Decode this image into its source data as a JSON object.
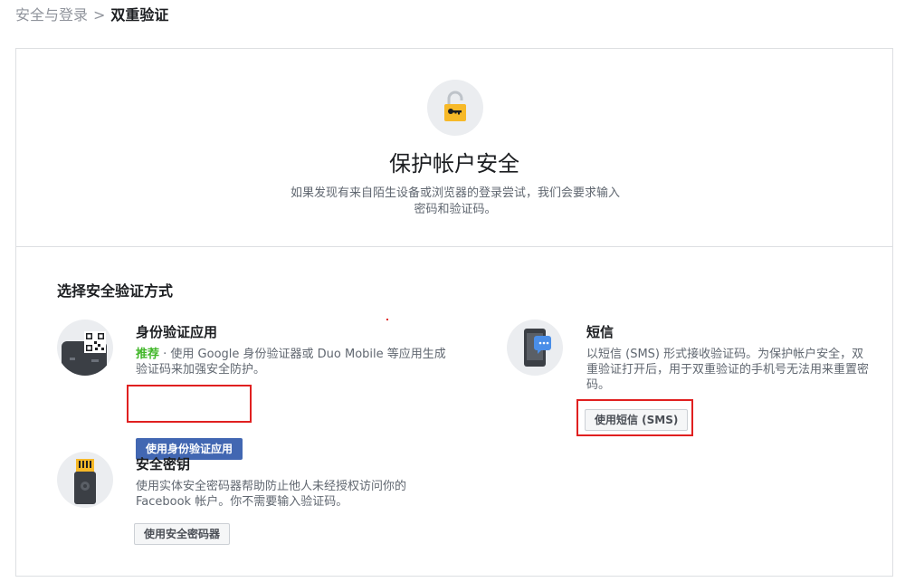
{
  "breadcrumb": {
    "parent": "安全与登录",
    "separator": ">",
    "current": "双重验证"
  },
  "hero": {
    "title": "保护帐户安全",
    "description": "如果发现有来自陌生设备或浏览器的登录尝试，我们会要求输入密码和验证码。"
  },
  "section": {
    "title": "选择安全验证方式"
  },
  "options": {
    "auth_app": {
      "title": "身份验证应用",
      "recommended": "推荐",
      "description": " · 使用 Google 身份验证器或 Duo Mobile 等应用生成验证码来加强安全防护。",
      "button": "使用身份验证应用"
    },
    "sms": {
      "title": "短信",
      "description": "以短信 (SMS) 形式接收验证码。为保护帐户安全，双重验证打开后，用于双重验证的手机号无法用来重置密码。",
      "button": "使用短信 (SMS)"
    },
    "security_key": {
      "title": "安全密钥",
      "description": "使用实体安全密码器帮助防止他人未经授权访问你的 Facebook 帐户。你不需要输入验证码。",
      "button": "使用安全密码器"
    }
  },
  "colors": {
    "primary": "#4267b2",
    "recommended": "#42b72a",
    "highlight": "#e02020",
    "lock": "#f7b928"
  }
}
